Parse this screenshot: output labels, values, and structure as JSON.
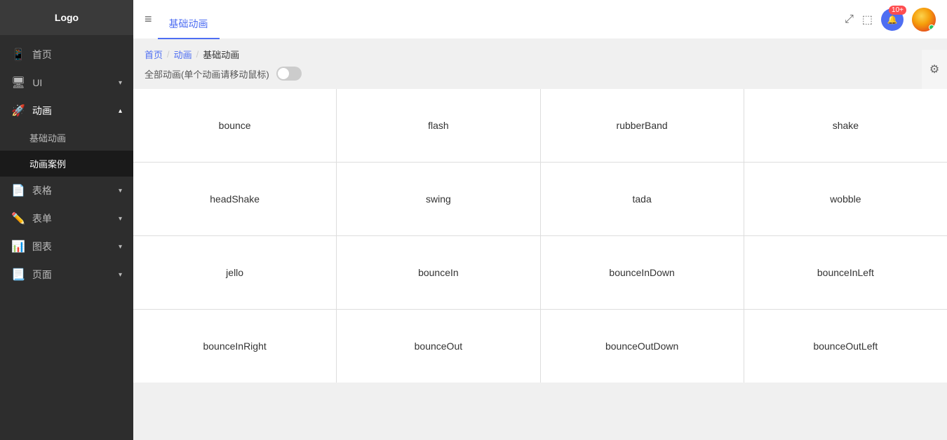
{
  "sidebar": {
    "logo": "Logo",
    "items": [
      {
        "id": "home",
        "label": "首页",
        "icon": "📱",
        "hasArrow": false,
        "active": false
      },
      {
        "id": "ui",
        "label": "UI",
        "icon": "🖥",
        "hasArrow": true,
        "active": false
      },
      {
        "id": "animation",
        "label": "动画",
        "icon": "🚀",
        "hasArrow": true,
        "active": true
      },
      {
        "id": "table",
        "label": "表格",
        "icon": "📄",
        "hasArrow": true,
        "active": false
      },
      {
        "id": "form",
        "label": "表单",
        "icon": "✏️",
        "hasArrow": true,
        "active": false
      },
      {
        "id": "chart",
        "label": "图表",
        "icon": "📊",
        "hasArrow": true,
        "active": false
      },
      {
        "id": "page",
        "label": "页面",
        "icon": "📃",
        "hasArrow": true,
        "active": false
      }
    ],
    "subItems": [
      {
        "id": "basic-animation",
        "label": "基础动画",
        "active": false
      },
      {
        "id": "animation-cases",
        "label": "动画案例",
        "active": true
      }
    ]
  },
  "header": {
    "menuIcon": "≡",
    "tabs": [
      {
        "id": "tab1",
        "label": "基础动画",
        "active": true
      }
    ],
    "notificationCount": "10+",
    "expandIcon": "⤢",
    "screenIcon": "⬚"
  },
  "breadcrumb": {
    "items": [
      "首页",
      "动画",
      "基础动画"
    ],
    "separators": [
      "/",
      "/"
    ]
  },
  "toggleLabel": "全部动画(单个动画请移动鼠标)",
  "animationCards": [
    "bounce",
    "flash",
    "rubberBand",
    "shake",
    "headShake",
    "swing",
    "tada",
    "wobble",
    "jello",
    "bounceIn",
    "bounceInDown",
    "bounceInLeft",
    "bounceInRight",
    "bounceOut",
    "bounceOutDown",
    "bounceOutLeft"
  ],
  "settingsIcon": "⚙"
}
